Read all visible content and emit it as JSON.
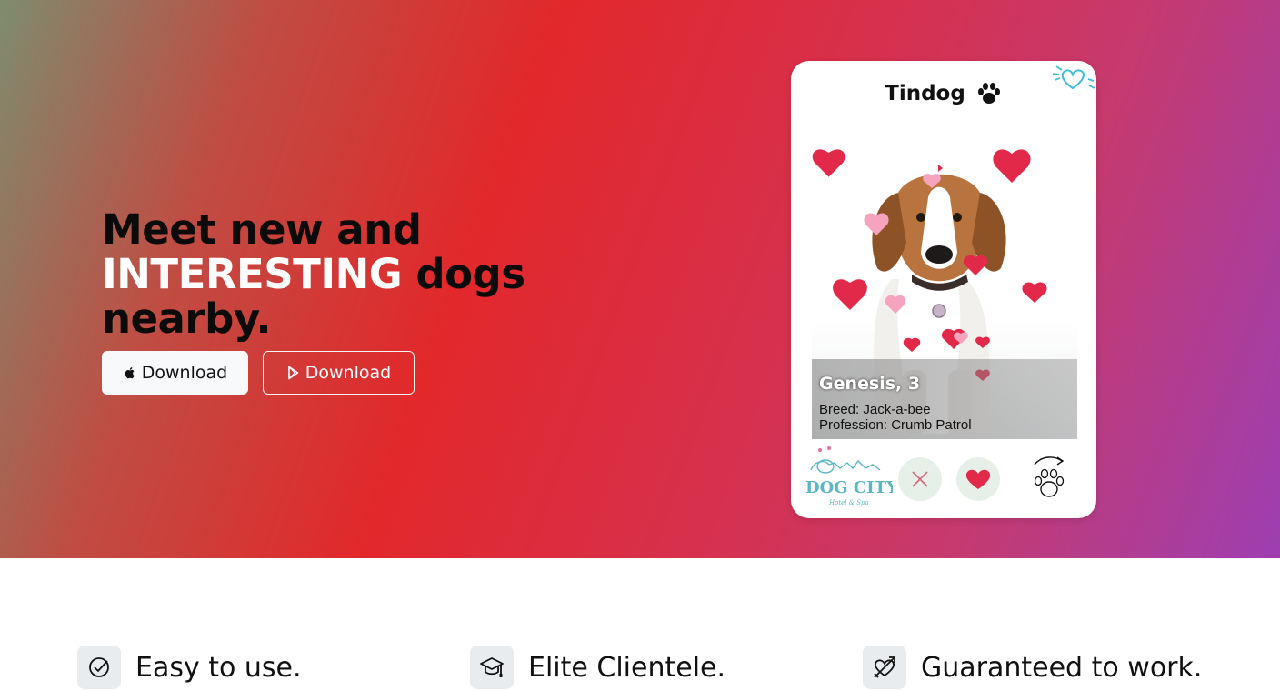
{
  "hero": {
    "headline_part1": "Meet new and",
    "headline_highlight": "INTERESTING",
    "headline_part2": " dogs nearby.",
    "apple_button_label": "Download",
    "play_button_label": "Download",
    "gradient_colors": [
      "#7e8c6e",
      "#e2282b",
      "#9d3fb2"
    ]
  },
  "phone": {
    "app_name": "Tindog",
    "dog_name": "Genesis, 3",
    "breed": "Breed: Jack-a-bee",
    "profession": "Profession: Crumb Patrol",
    "sponsor_logo_text": "DOG CITY",
    "sponsor_logo_subtext": "Hotel & Spa",
    "accent_heart_color": "#e2294a",
    "button_bg_color": "#e6f0e9"
  },
  "features": [
    {
      "title": "Easy to use.",
      "icon": "circle-check-icon"
    },
    {
      "title": "Elite Clientele.",
      "icon": "mortarboard-icon"
    },
    {
      "title": "Guaranteed to work.",
      "icon": "heart-arrow-icon"
    }
  ]
}
